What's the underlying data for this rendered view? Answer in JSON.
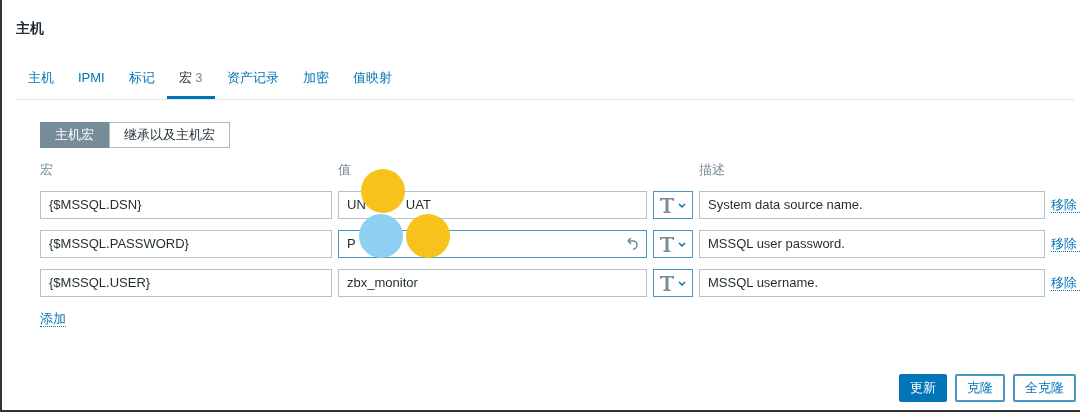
{
  "title": "主机",
  "tabs": [
    {
      "label": "主机",
      "selected": false
    },
    {
      "label": "IPMI",
      "selected": false
    },
    {
      "label": "标记",
      "selected": false
    },
    {
      "label": "宏",
      "count": "3",
      "selected": true
    },
    {
      "label": "资产记录",
      "selected": false
    },
    {
      "label": "加密",
      "selected": false
    },
    {
      "label": "值映射",
      "selected": false
    }
  ],
  "macro_modes": [
    {
      "label": "主机宏",
      "selected": true
    },
    {
      "label": "继承以及主机宏",
      "selected": false
    }
  ],
  "columns": [
    "宏",
    "值",
    "描述"
  ],
  "macros": [
    {
      "macro": "{$MSSQL.DSN}",
      "value_parts": [
        "UN",
        "UAT"
      ],
      "focused": false,
      "changed": false,
      "description": "System data source name.",
      "remove": "移除"
    },
    {
      "macro": "{$MSSQL.PASSWORD}",
      "value_parts": [
        "P"
      ],
      "focused": true,
      "changed": true,
      "description": "MSSQL user password.",
      "remove": "移除"
    },
    {
      "macro": "{$MSSQL.USER}",
      "value_parts": [
        "zbx_monitor"
      ],
      "focused": false,
      "changed": false,
      "description": "MSSQL username.",
      "remove": "移除"
    }
  ],
  "add_link": "添加",
  "buttons": [
    {
      "label": "更新",
      "kind": "primary"
    },
    {
      "label": "克隆",
      "kind": "outline"
    },
    {
      "label": "全克隆",
      "kind": "outline"
    }
  ]
}
